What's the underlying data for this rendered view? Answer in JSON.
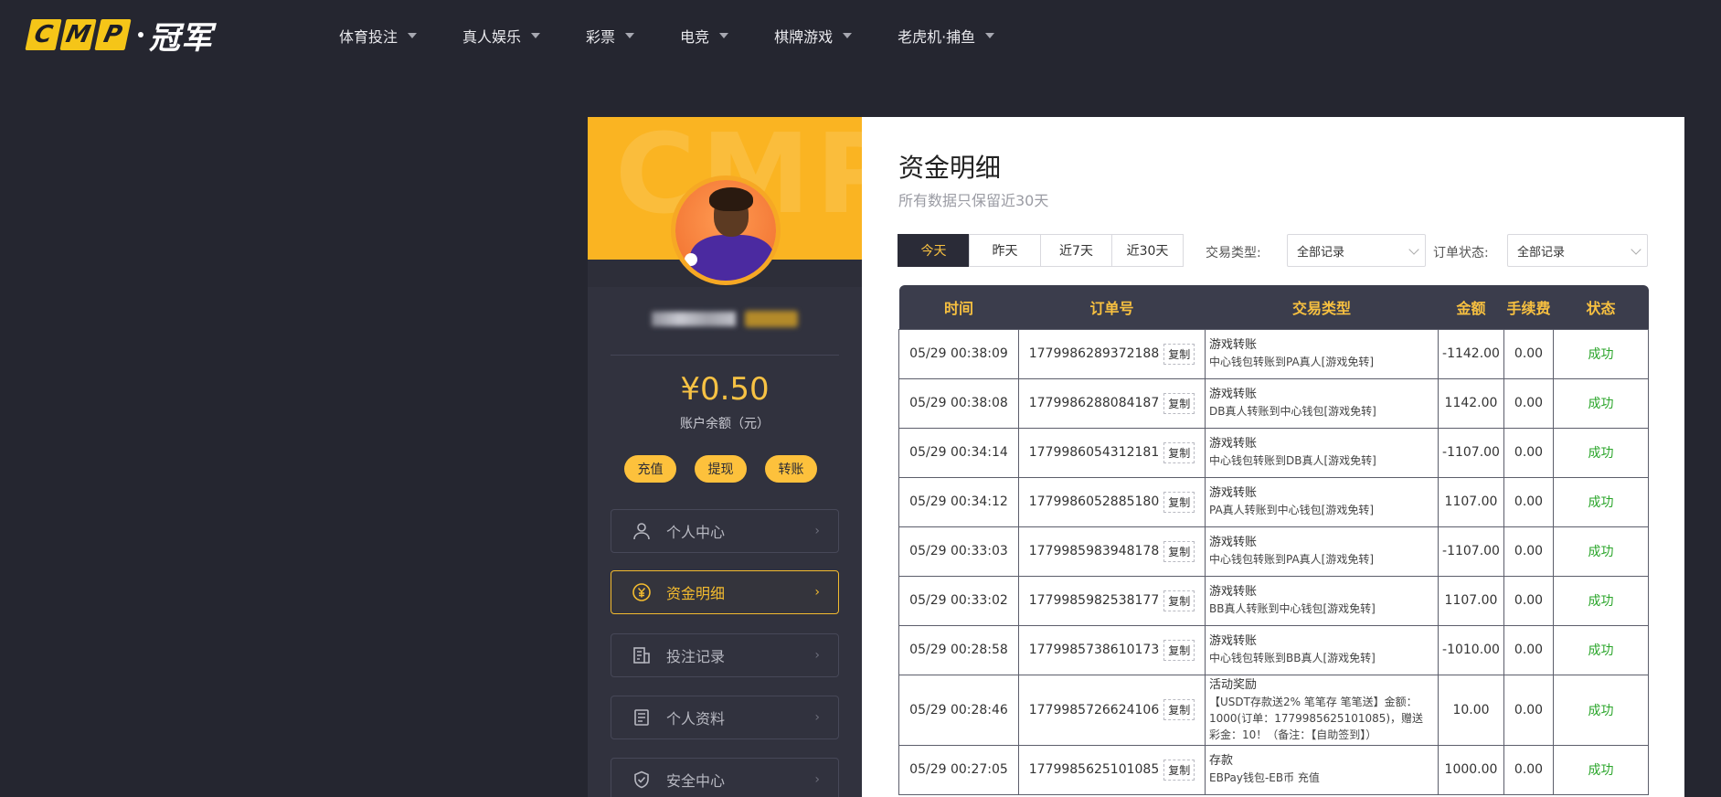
{
  "header": {
    "logo_letters": [
      "C",
      "M",
      "P"
    ],
    "logo_text": "冠军",
    "nav": [
      {
        "label": "体育投注"
      },
      {
        "label": "真人娱乐"
      },
      {
        "label": "彩票"
      },
      {
        "label": "电竞"
      },
      {
        "label": "棋牌游戏"
      },
      {
        "label": "老虎机·捕鱼"
      }
    ]
  },
  "sidebar": {
    "watermark": "CMP",
    "balance": "¥0.50",
    "balance_label": "账户余额（元）",
    "quick_actions": [
      "充值",
      "提现",
      "转账"
    ],
    "menu": [
      {
        "label": "个人中心",
        "icon": "user-icon",
        "active": false
      },
      {
        "label": "资金明细",
        "icon": "yuan-coin-icon",
        "active": true
      },
      {
        "label": "投注记录",
        "icon": "receipt-icon",
        "active": false
      },
      {
        "label": "个人资料",
        "icon": "document-icon",
        "active": false
      },
      {
        "label": "安全中心",
        "icon": "shield-check-icon",
        "active": false
      }
    ]
  },
  "main": {
    "title": "资金明细",
    "subtitle": "所有数据只保留近30天",
    "date_tabs": [
      {
        "label": "今天",
        "active": true
      },
      {
        "label": "昨天",
        "active": false
      },
      {
        "label": "近7天",
        "active": false
      },
      {
        "label": "近30天",
        "active": false
      }
    ],
    "filters": {
      "type_label": "交易类型:",
      "type_value": "全部记录",
      "status_label": "订单状态:",
      "status_value": "全部记录"
    },
    "table": {
      "headers": [
        "时间",
        "订单号",
        "交易类型",
        "金额",
        "手续费",
        "状态"
      ],
      "copy_label": "复制",
      "rows": [
        {
          "time": "05/29 00:38:09",
          "order": "1779986289372188",
          "type": "游戏转账",
          "desc": "中心钱包转账到PA真人[游戏免转]",
          "amount": "-1142.00",
          "fee": "0.00",
          "status": "成功"
        },
        {
          "time": "05/29 00:38:08",
          "order": "1779986288084187",
          "type": "游戏转账",
          "desc": "DB真人转账到中心钱包[游戏免转]",
          "amount": "1142.00",
          "fee": "0.00",
          "status": "成功"
        },
        {
          "time": "05/29 00:34:14",
          "order": "1779986054312181",
          "type": "游戏转账",
          "desc": "中心钱包转账到DB真人[游戏免转]",
          "amount": "-1107.00",
          "fee": "0.00",
          "status": "成功"
        },
        {
          "time": "05/29 00:34:12",
          "order": "1779986052885180",
          "type": "游戏转账",
          "desc": "PA真人转账到中心钱包[游戏免转]",
          "amount": "1107.00",
          "fee": "0.00",
          "status": "成功"
        },
        {
          "time": "05/29 00:33:03",
          "order": "1779985983948178",
          "type": "游戏转账",
          "desc": "中心钱包转账到PA真人[游戏免转]",
          "amount": "-1107.00",
          "fee": "0.00",
          "status": "成功"
        },
        {
          "time": "05/29 00:33:02",
          "order": "1779985982538177",
          "type": "游戏转账",
          "desc": "BB真人转账到中心钱包[游戏免转]",
          "amount": "1107.00",
          "fee": "0.00",
          "status": "成功"
        },
        {
          "time": "05/29 00:28:58",
          "order": "1779985738610173",
          "type": "游戏转账",
          "desc": "中心钱包转账到BB真人[游戏免转]",
          "amount": "-1010.00",
          "fee": "0.00",
          "status": "成功"
        },
        {
          "time": "05/29 00:28:46",
          "order": "1779985726624106",
          "type": "活动奖励",
          "desc": "【USDT存款送2% 笔笔存 笔笔送】金额：1000(订单：1779985625101085)，赠送彩金：10！（备注：【自助签到】）",
          "amount": "10.00",
          "fee": "0.00",
          "status": "成功"
        },
        {
          "time": "05/29 00:27:05",
          "order": "1779985625101085",
          "type": "存款",
          "desc": "EBPay钱包-EB币 充值",
          "amount": "1000.00",
          "fee": "0.00",
          "status": "成功"
        }
      ]
    }
  },
  "colors": {
    "page_bg": "#252630",
    "accent_yellow": "#f7c040",
    "sidebar_bg": "#31323e",
    "success_green": "#2aa52a"
  }
}
